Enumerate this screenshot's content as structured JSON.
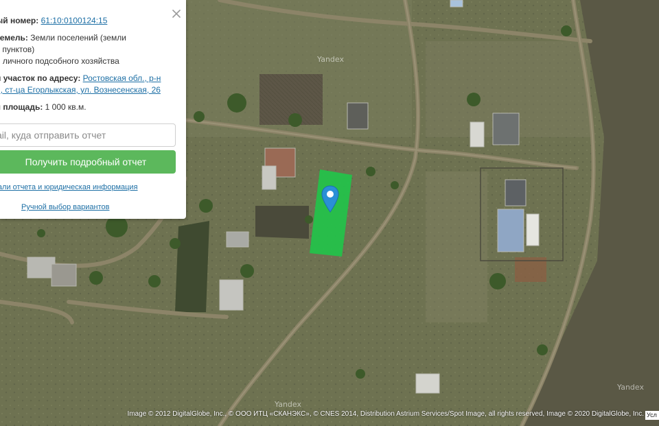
{
  "panel": {
    "cadastral_label": "ый номер:",
    "cadastral_value": "61:10:0100124:15",
    "category_label": "земель:",
    "category_line1": "Земли поселений (земли",
    "category_line2": "х пунктов)",
    "category_line3": "я личного подсобного хозяйства",
    "address_label": "й участок по адресу:",
    "address_line1": "Ростовская обл., р-н",
    "address_line2": "й, ст-ца Егорлыкская, ул. Вознесенская, 26",
    "area_label": "я площадь:",
    "area_value": "1 000 кв.м.",
    "email_placeholder": "ail, куда отправить отчет",
    "report_button": "Получить подробный отчет",
    "details_link": "тали отчета и юридическая информация",
    "manual_link": "Ручной выбор вариантов",
    "close_icon": "close-icon"
  },
  "map": {
    "watermarks": [
      "Yandex",
      "Yandex",
      "Yandex"
    ],
    "attribution": "Image © 2012 DigitalGlobe, Inc., © ООО ИТЦ «СКАНЭКС», © CNES 2014, Distribution Astrium Services/Spot Image, all rights reserved, Image © 2020 DigitalGlobe, Inc.",
    "terms": "Усл",
    "parcel_color": "#22c34a",
    "marker_color": "#2a8fd6",
    "marker_icon": "map-pin-icon"
  }
}
